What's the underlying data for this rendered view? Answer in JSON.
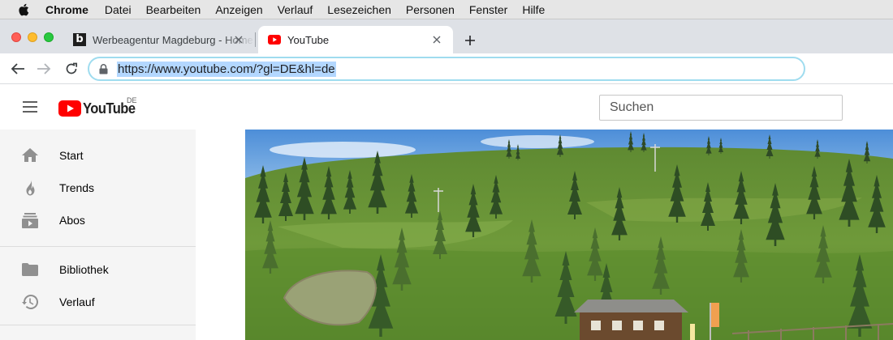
{
  "os_menubar": {
    "app_name": "Chrome",
    "items": [
      "Datei",
      "Bearbeiten",
      "Anzeigen",
      "Verlauf",
      "Lesezeichen",
      "Personen",
      "Fenster",
      "Hilfe"
    ]
  },
  "tabs": [
    {
      "title": "Werbeagentur Magdeburg - Home",
      "favicon_letter": "b",
      "active": false
    },
    {
      "title": "YouTube",
      "active": true
    }
  ],
  "toolbar": {
    "url": "https://www.youtube.com/?gl=DE&hl=de"
  },
  "masthead": {
    "logo_text": "YouTube",
    "country_code": "DE",
    "search_placeholder": "Suchen"
  },
  "sidebar": {
    "primary": [
      {
        "label": "Start",
        "icon": "home-icon"
      },
      {
        "label": "Trends",
        "icon": "flame-icon"
      },
      {
        "label": "Abos",
        "icon": "subscriptions-icon"
      }
    ],
    "secondary": [
      {
        "label": "Bibliothek",
        "icon": "folder-icon"
      },
      {
        "label": "Verlauf",
        "icon": "history-icon"
      }
    ]
  },
  "colors": {
    "youtube_red": "#ff0000",
    "selection_blue": "#b3d7ff",
    "omnibox_focus": "#9fdcef",
    "sidebar_bg": "#f5f5f5"
  }
}
